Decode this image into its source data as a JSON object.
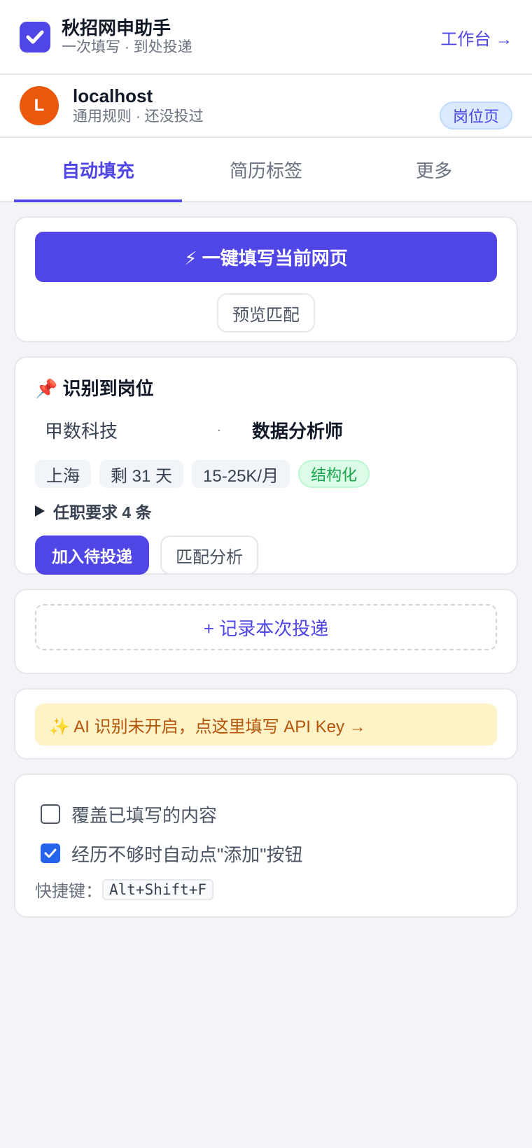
{
  "header": {
    "app_name": "秋招网申助手",
    "tagline": "一次填写 · 到处投递",
    "workbench_link": "工作台 →"
  },
  "site": {
    "avatar_letter": "L",
    "host": "localhost",
    "status": "通用规则 · 还没投过",
    "page_type_badge": "岗位页"
  },
  "tabs": [
    {
      "label": "自动填充",
      "active": true
    },
    {
      "label": "简历标签",
      "active": false
    },
    {
      "label": "更多",
      "active": false
    }
  ],
  "fill_card": {
    "primary_label": "⚡ 一键填写当前网页",
    "preview_label": "预览匹配"
  },
  "job_card": {
    "title": "📌 识别到岗位",
    "company": "甲数科技",
    "separator": "·",
    "position": "数据分析师",
    "chips": [
      "上海",
      "剩 31 天",
      "15-25K/月"
    ],
    "structured_badge": "结构化",
    "requirements_toggle": "任职要求 4 条",
    "add_queue_label": "加入待投递",
    "match_analysis_label": "匹配分析"
  },
  "record_card": {
    "record_label": "+ 记录本次投递"
  },
  "ai_card": {
    "banner_text": "✨ AI 识别未开启，点这里填写 API Key →"
  },
  "options": {
    "overwrite_label": "覆盖已填写的内容",
    "overwrite_checked": false,
    "auto_add_label": "经历不够时自动点\"添加\"按钮",
    "auto_add_checked": true,
    "shortcut_prefix": "快捷键：",
    "shortcut_keys": "Alt+Shift+F"
  },
  "colors": {
    "accent": "#4f46e5",
    "avatar": "#ea580c",
    "checkbox_checked": "#2563eb",
    "ai_banner_bg": "#fef3c7",
    "ai_banner_text": "#b45309",
    "structured_badge": "#16a34a"
  },
  "icons": {
    "logo": "check-icon",
    "requirements": "triangle-right-icon"
  }
}
